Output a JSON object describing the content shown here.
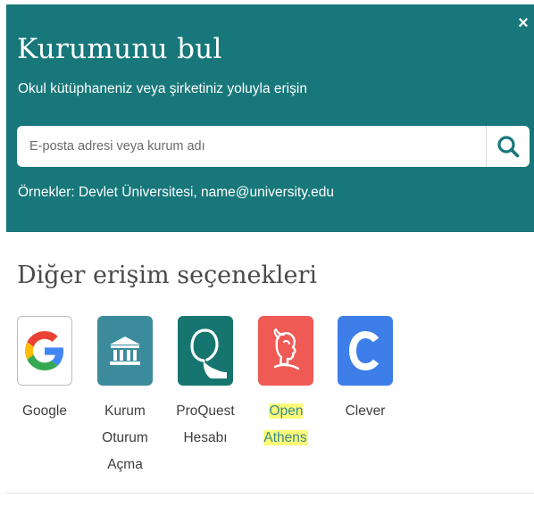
{
  "header": {
    "title": "Kurumunu bul",
    "subtitle": "Okul kütüphaneniz veya şirketiniz yoluyla erişin",
    "close_label": "×",
    "background_color": "#17777a"
  },
  "search": {
    "placeholder": "E-posta adresi veya kurum adı",
    "value": "",
    "button_icon": "search-icon"
  },
  "examples_text": "Örnekler: Devlet Üniversitesi, name@university.edu",
  "other_options": {
    "title": "Diğer erişim seçenekleri",
    "items": [
      {
        "id": "google",
        "lines": [
          "Google"
        ],
        "icon": "google-g-icon",
        "color": "#ffffff"
      },
      {
        "id": "kurum",
        "lines": [
          "Kurum",
          "Oturum",
          "Açma"
        ],
        "icon": "institution-building-icon",
        "color": "#3b8b9c"
      },
      {
        "id": "proquest",
        "lines": [
          "ProQuest",
          "Hesabı"
        ],
        "icon": "proquest-q-icon",
        "color": "#16766f"
      },
      {
        "id": "openathens",
        "lines": [
          "Open Athens"
        ],
        "icon": "athena-head-icon",
        "color": "#ef5a55",
        "highlighted": true
      },
      {
        "id": "clever",
        "lines": [
          "Clever"
        ],
        "icon": "clever-c-icon",
        "color": "#3d7ee9"
      }
    ]
  }
}
